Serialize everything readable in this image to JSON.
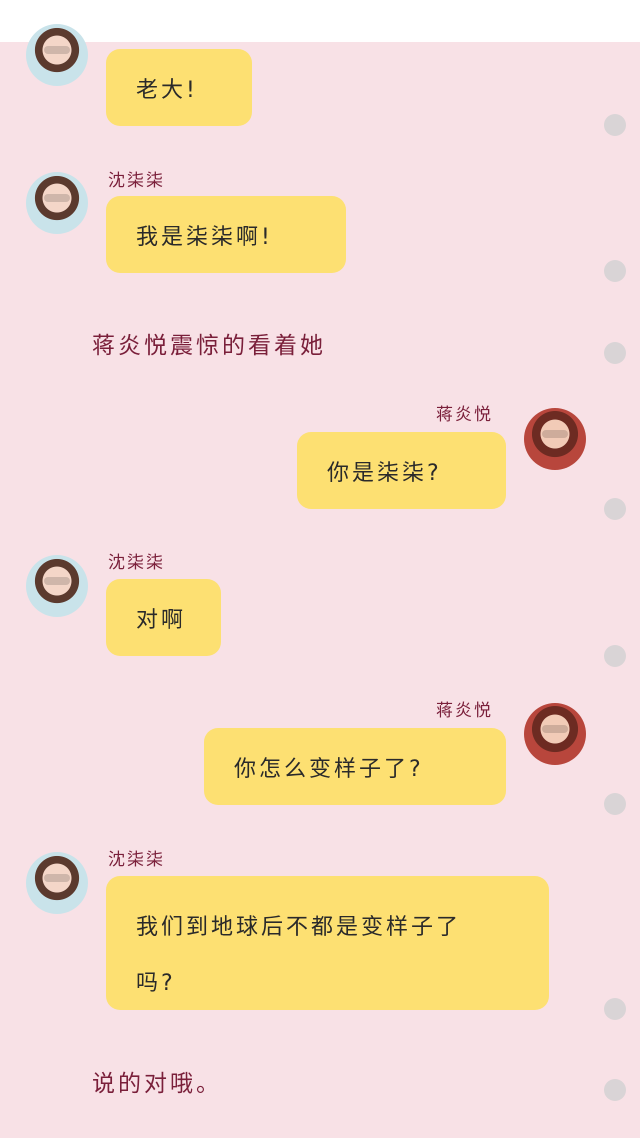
{
  "colors": {
    "background": "#f8e1e6",
    "bubble": "#fde072",
    "name": "#7a1f3a"
  },
  "messages": [
    {
      "name": "",
      "text": "老大!"
    },
    {
      "name": "沈柒柒",
      "text": "我是柒柒啊!"
    },
    {
      "narration": "蒋炎悦震惊的看着她"
    },
    {
      "name": "蒋炎悦",
      "text": "你是柒柒?"
    },
    {
      "name": "沈柒柒",
      "text": "对啊"
    },
    {
      "name": "蒋炎悦",
      "text": "你怎么变样子了?"
    },
    {
      "name": "沈柒柒",
      "text": "我们到地球后不都是变样子了吗?"
    },
    {
      "narration": "说的对哦。"
    }
  ]
}
